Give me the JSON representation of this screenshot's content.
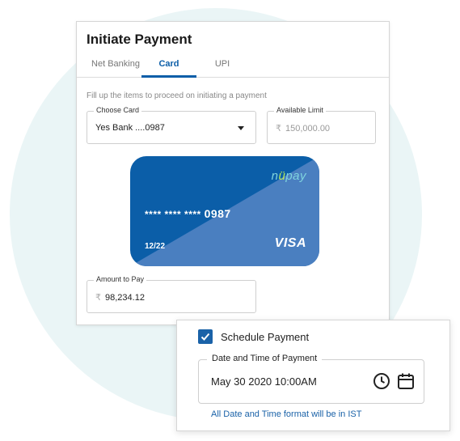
{
  "panel": {
    "title": "Initiate Payment",
    "tabs": [
      {
        "label": "Net Banking",
        "active": false
      },
      {
        "label": "Card",
        "active": true
      },
      {
        "label": "UPI",
        "active": false
      }
    ],
    "hint": "Fill up the items to proceed on initiating a payment",
    "choose_card": {
      "label": "Choose Card",
      "value": "Yes Bank ....0987"
    },
    "available_limit": {
      "label": "Available Limit",
      "currency": "₹",
      "value": "150,000.00"
    },
    "card": {
      "brand_prefix": "n",
      "brand_accent": "ü",
      "brand_suffix": "pay",
      "masked": "**** **** ****",
      "last4": "0987",
      "expiry": "12/22",
      "network": "VISA",
      "colors": {
        "primary": "#0b5ea8",
        "secondary": "#4a7fc0"
      }
    },
    "amount": {
      "label": "Amount to Pay",
      "currency": "₹",
      "value": "98,234.12"
    }
  },
  "schedule": {
    "checked": true,
    "label": "Schedule Payment",
    "datetime": {
      "label": "Date and Time of Payment",
      "value": "May 30 2020 10:00AM"
    },
    "icons": [
      "clock-icon",
      "calendar-icon"
    ],
    "note": "All Date and Time format will be in IST"
  },
  "colors": {
    "accent": "#0b5ea8",
    "background_circle": "#eaf5f6"
  }
}
